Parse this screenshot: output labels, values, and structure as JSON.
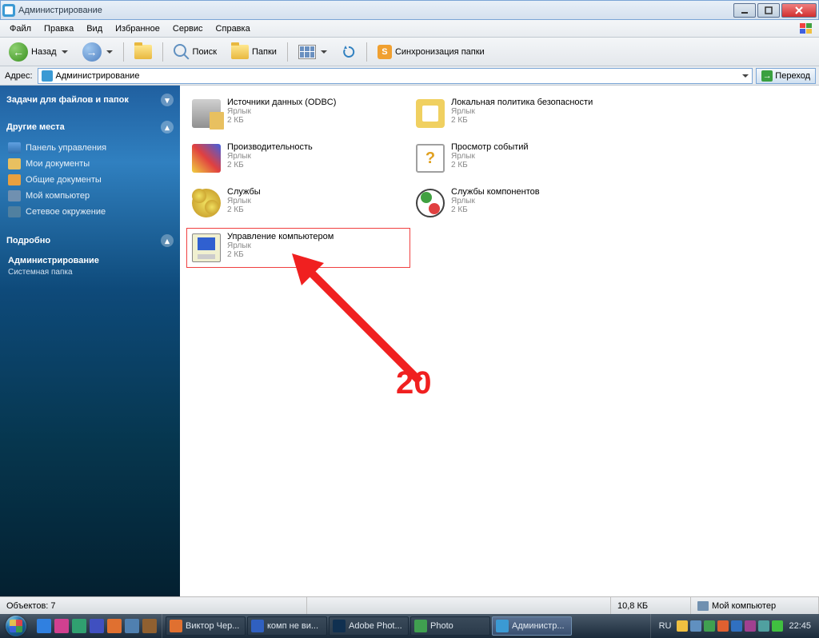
{
  "window": {
    "title": "Администрирование"
  },
  "menu": {
    "file": "Файл",
    "edit": "Правка",
    "view": "Вид",
    "favorites": "Избранное",
    "tools": "Сервис",
    "help": "Справка"
  },
  "toolbar": {
    "back": "Назад",
    "search": "Поиск",
    "folders": "Папки",
    "sync": "Синхронизация папки"
  },
  "address": {
    "label": "Адрес:",
    "value": "Администрирование",
    "go": "Переход"
  },
  "sidebar": {
    "tasks_header": "Задачи для файлов и папок",
    "places_header": "Другие места",
    "places": {
      "control_panel": "Панель управления",
      "my_documents": "Мои документы",
      "shared_documents": "Общие документы",
      "my_computer": "Мой компьютер",
      "network": "Сетевое окружение"
    },
    "details_header": "Подробно",
    "details_title": "Администрирование",
    "details_sub": "Системная папка"
  },
  "items": [
    {
      "name": "Источники данных (ODBC)",
      "type": "Ярлык",
      "size": "2 КБ",
      "icon": "odbc"
    },
    {
      "name": "Локальная политика безопасности",
      "type": "Ярлык",
      "size": "2 КБ",
      "icon": "sec"
    },
    {
      "name": "Производительность",
      "type": "Ярлык",
      "size": "2 КБ",
      "icon": "perf"
    },
    {
      "name": "Просмотр событий",
      "type": "Ярлык",
      "size": "2 КБ",
      "icon": "event"
    },
    {
      "name": "Службы",
      "type": "Ярлык",
      "size": "2 КБ",
      "icon": "svc"
    },
    {
      "name": "Службы компонентов",
      "type": "Ярлык",
      "size": "2 КБ",
      "icon": "comp-svc"
    },
    {
      "name": "Управление компьютером",
      "type": "Ярлык",
      "size": "2 КБ",
      "icon": "mgmt",
      "selected": true
    }
  ],
  "annotation": {
    "number": "20"
  },
  "statusbar": {
    "objects": "Объектов: 7",
    "size": "10,8 КБ",
    "location": "Мой компьютер"
  },
  "taskbar": {
    "tasks": [
      {
        "label": "Виктор Чер...",
        "color": "#e07030"
      },
      {
        "label": "комп не ви...",
        "color": "#3060c0"
      },
      {
        "label": "Adobe Phot...",
        "color": "#103050"
      },
      {
        "label": "Photo",
        "color": "#40a050"
      },
      {
        "label": "Администр...",
        "color": "#3b9ad4",
        "active": true
      }
    ],
    "lang": "RU",
    "clock": "22:45"
  }
}
